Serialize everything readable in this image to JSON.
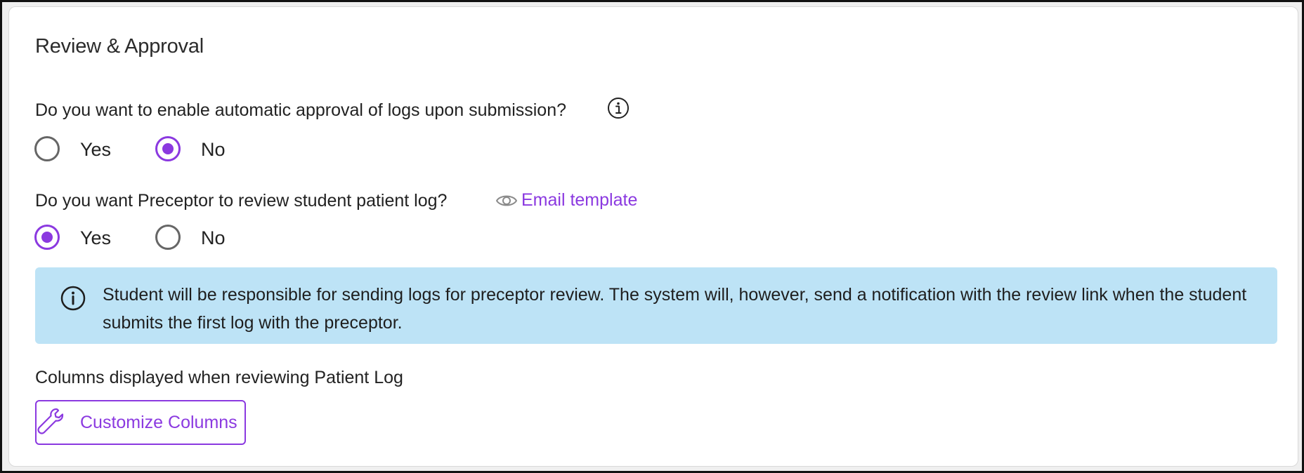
{
  "section": {
    "title": "Review & Approval"
  },
  "auto_approval": {
    "question": "Do you want to enable automatic approval of logs upon submission?",
    "info_icon": "info-circle-icon",
    "options": [
      {
        "label": "Yes",
        "selected": false
      },
      {
        "label": "No",
        "selected": true
      }
    ]
  },
  "preceptor_review": {
    "question": "Do you want Preceptor to review student patient log?",
    "email_link": {
      "icon": "eye-icon",
      "label": "Email template"
    },
    "options": [
      {
        "label": "Yes",
        "selected": true
      },
      {
        "label": "No",
        "selected": false
      }
    ]
  },
  "notice": {
    "icon": "info-circle-icon",
    "text": "Student will be responsible for sending logs for preceptor review. The system will, however, send a notification with the review link when the student submits the first log with the preceptor."
  },
  "columns": {
    "label": "Columns displayed when reviewing Patient Log",
    "button": {
      "icon": "wrench-icon",
      "label": "Customize Columns"
    }
  },
  "colors": {
    "accent": "#8b39e0",
    "banner_bg": "#bde3f6",
    "text": "#222222"
  }
}
